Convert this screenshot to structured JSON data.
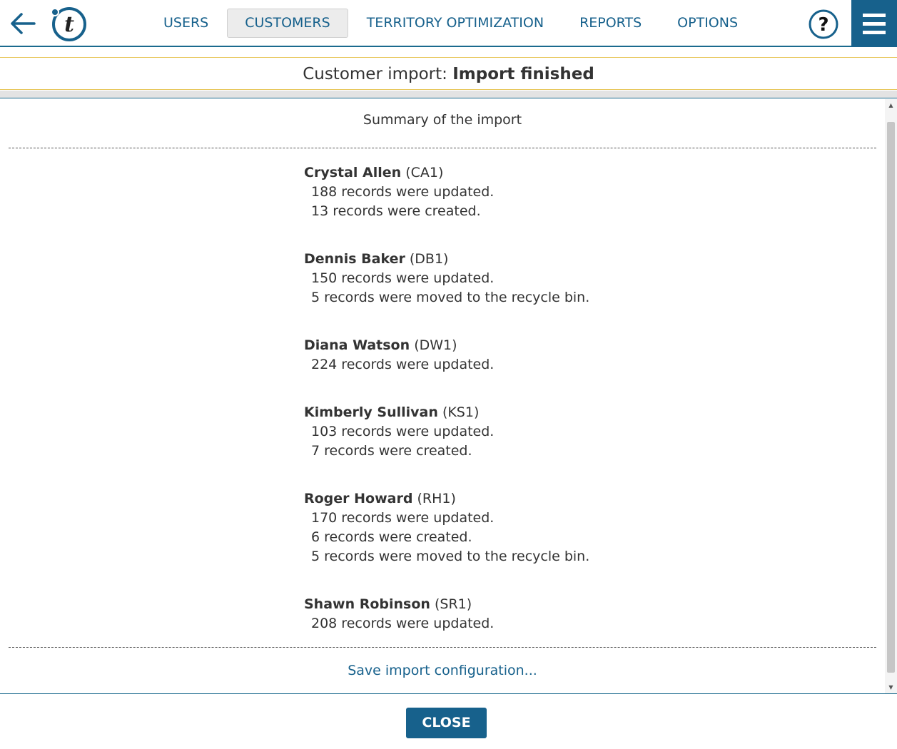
{
  "nav": {
    "items": [
      {
        "label": "USERS",
        "active": false
      },
      {
        "label": "CUSTOMERS",
        "active": true
      },
      {
        "label": "TERRITORY OPTIMIZATION",
        "active": false
      },
      {
        "label": "REPORTS",
        "active": false
      },
      {
        "label": "OPTIONS",
        "active": false
      }
    ]
  },
  "icons": {
    "back": "arrow-left-icon",
    "logo": "app-logo-t",
    "help": "question-mark-icon",
    "menu": "hamburger-menu-icon"
  },
  "title": {
    "prefix": "Customer import:",
    "status": "Import finished"
  },
  "summary": {
    "heading": "Summary of the import",
    "entries": [
      {
        "name": "Crystal Allen",
        "code": "(CA1)",
        "lines": [
          "188 records were updated.",
          "13 records were created."
        ]
      },
      {
        "name": "Dennis Baker",
        "code": "(DB1)",
        "lines": [
          "150 records were updated.",
          "5 records were moved to the recycle bin."
        ]
      },
      {
        "name": "Diana Watson",
        "code": "(DW1)",
        "lines": [
          "224 records were updated."
        ]
      },
      {
        "name": "Kimberly Sullivan",
        "code": "(KS1)",
        "lines": [
          "103 records were updated.",
          "7 records were created."
        ]
      },
      {
        "name": "Roger Howard",
        "code": "(RH1)",
        "lines": [
          "170 records were updated.",
          "6 records were created.",
          "5 records were moved to the recycle bin."
        ]
      },
      {
        "name": "Shawn Robinson",
        "code": "(SR1)",
        "lines": [
          "208 records were updated."
        ]
      }
    ],
    "save_link": "Save import configuration..."
  },
  "footer": {
    "close_label": "CLOSE"
  },
  "colors": {
    "brand": "#17618c",
    "title_border": "#e7c659",
    "active_tab_bg": "#ececec"
  }
}
